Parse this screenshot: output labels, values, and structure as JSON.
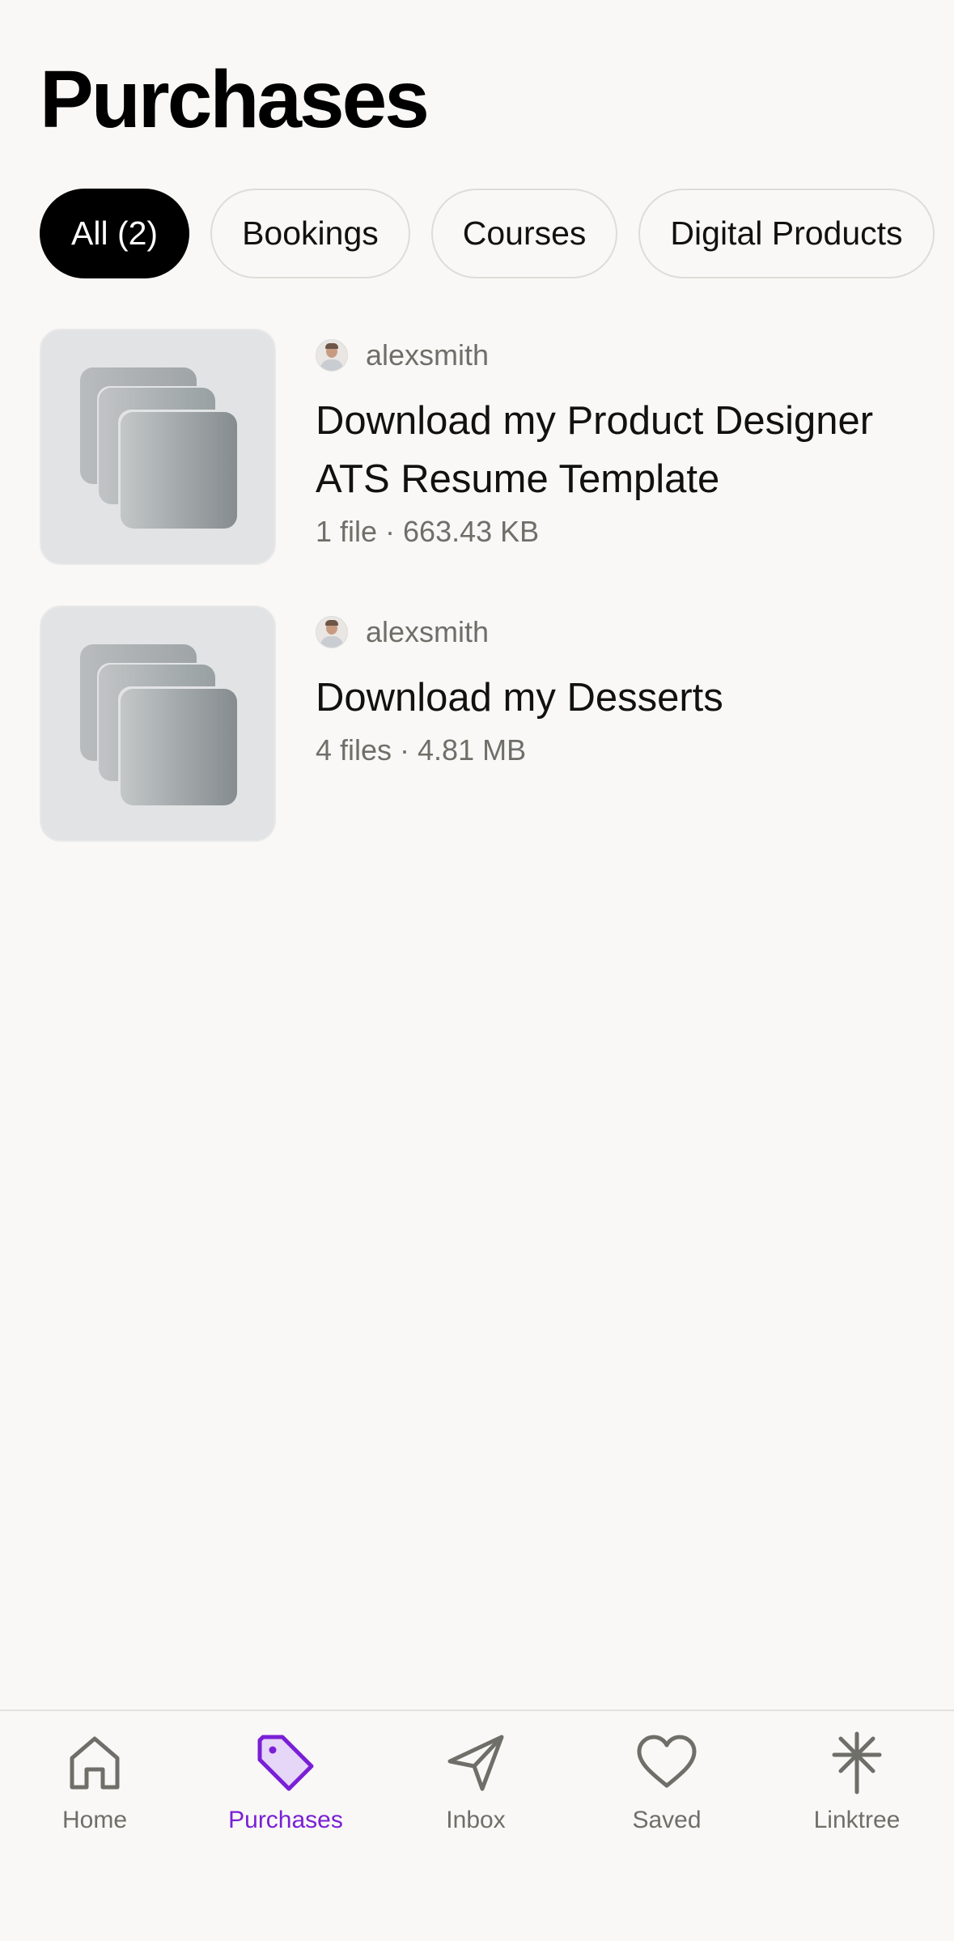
{
  "page": {
    "title": "Purchases"
  },
  "filters": [
    {
      "label": "All (2)",
      "active": true
    },
    {
      "label": "Bookings",
      "active": false
    },
    {
      "label": "Courses",
      "active": false
    },
    {
      "label": "Digital Products",
      "active": false
    }
  ],
  "items": [
    {
      "seller": "alexsmith",
      "title": "Download my Product Designer ATS Resume Template",
      "meta": "1 file · 663.43 KB"
    },
    {
      "seller": "alexsmith",
      "title": "Download my Desserts",
      "meta": "4 files · 4.81 MB"
    }
  ],
  "tabs": [
    {
      "label": "Home",
      "icon": "home-icon"
    },
    {
      "label": "Purchases",
      "icon": "tag-icon",
      "active": true
    },
    {
      "label": "Inbox",
      "icon": "send-icon"
    },
    {
      "label": "Saved",
      "icon": "heart-icon"
    },
    {
      "label": "Linktree",
      "icon": "linktree-asterisk-icon"
    }
  ],
  "colors": {
    "accent": "#7a1fd6",
    "background": "#f9f8f6",
    "muted_text": "#6f6f69"
  }
}
